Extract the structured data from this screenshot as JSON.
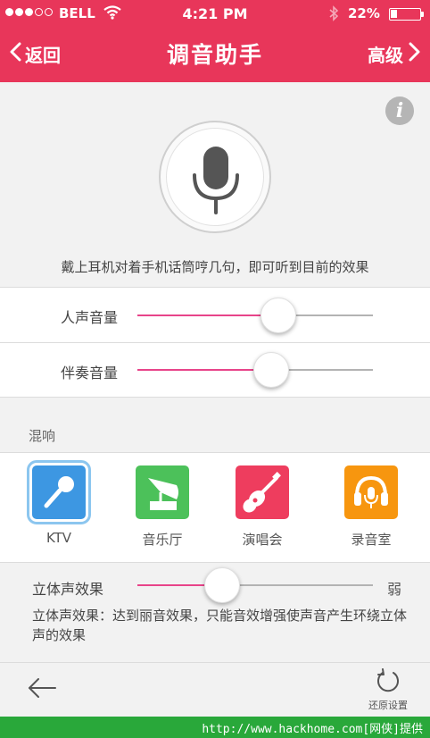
{
  "status_bar": {
    "carrier": "BELL",
    "time": "4:21 PM",
    "battery": "22%",
    "battery_level": 0.22
  },
  "nav": {
    "back_label": "返回",
    "title": "调音助手",
    "advanced_label": "高级"
  },
  "info_icon": "i",
  "hint": "戴上耳机对着手机话筒哼几句，即可听到目前的效果",
  "volumes": [
    {
      "label": "人声音量",
      "value": 0.6
    },
    {
      "label": "伴奏音量",
      "value": 0.57
    }
  ],
  "reverb": {
    "title": "混响",
    "effects": [
      {
        "label": "KTV",
        "icon": "microphone-icon",
        "color": "#3d97e2",
        "selected": true
      },
      {
        "label": "音乐厅",
        "icon": "gramophone-icon",
        "color": "#4cc15a",
        "selected": false
      },
      {
        "label": "演唱会",
        "icon": "guitar-icon",
        "color": "#ee3d5e",
        "selected": false
      },
      {
        "label": "录音室",
        "icon": "headphones-icon",
        "color": "#f7960f",
        "selected": false
      }
    ]
  },
  "stereo": {
    "label": "立体声效果",
    "value": 0.36,
    "end_label": "弱",
    "description": "立体声效果：达到丽音效果，只能音效增强使声音产生环绕立体声的效果"
  },
  "bottom": {
    "reset_label": "还原设置"
  },
  "watermark": "http://www.hackhome.com[网侠]提供",
  "colors": {
    "accent": "#e8365a",
    "slider_fill": "#e8448a",
    "watermark": "#29a83a"
  }
}
